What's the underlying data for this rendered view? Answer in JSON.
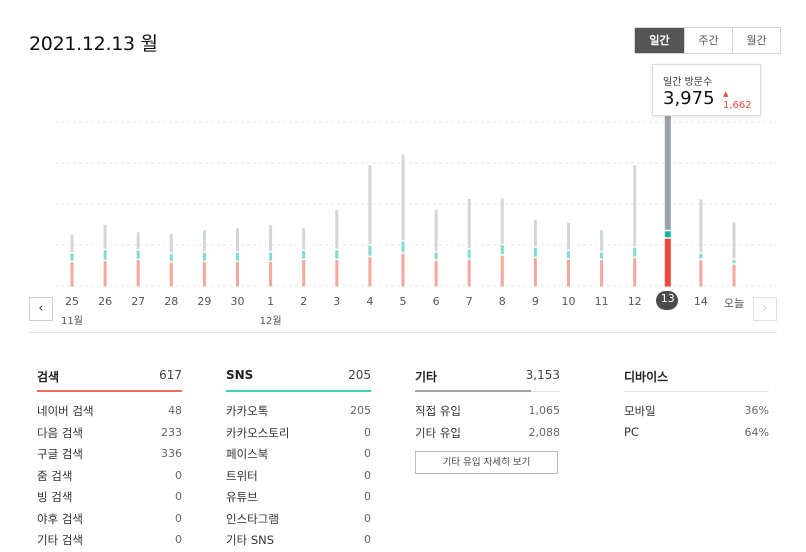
{
  "header": {
    "date_title": "2021.12.13 월"
  },
  "period_tabs": [
    {
      "label": "일간",
      "active": true
    },
    {
      "label": "주간",
      "active": false
    },
    {
      "label": "월간",
      "active": false
    }
  ],
  "tooltip": {
    "title": "일간 방문수",
    "value": "3,975",
    "diff": "1,662",
    "diff_direction": "up"
  },
  "chart_data": {
    "type": "bar",
    "stacked": true,
    "categories": [
      "25",
      "26",
      "27",
      "28",
      "29",
      "30",
      "1",
      "2",
      "3",
      "4",
      "5",
      "6",
      "7",
      "8",
      "9",
      "10",
      "11",
      "12",
      "13",
      "14",
      "오늘"
    ],
    "month_labels": [
      {
        "at": "25",
        "label": "11월"
      },
      {
        "at": "1",
        "label": "12월"
      }
    ],
    "selected_category": "13",
    "series": [
      {
        "color": "#f5a79b",
        "values": [
          520,
          540,
          560,
          510,
          520,
          520,
          520,
          560,
          560,
          620,
          690,
          550,
          570,
          650,
          600,
          570,
          560,
          600,
          990,
          560,
          470
        ]
      },
      {
        "color": "#7fdccf",
        "values": [
          170,
          220,
          190,
          170,
          190,
          190,
          190,
          190,
          200,
          230,
          240,
          160,
          200,
          210,
          210,
          170,
          150,
          210,
          150,
          130,
          90
        ]
      },
      {
        "color": "#d3d6d9",
        "values": [
          380,
          510,
          370,
          410,
          450,
          490,
          550,
          450,
          810,
          1620,
          1750,
          860,
          1020,
          940,
          560,
          570,
          450,
          1660,
          3200,
          1090,
          760
        ]
      }
    ],
    "selected_colors": [
      "#f0473b",
      "#19b4a0",
      "#9ca3aa"
    ],
    "ylim": [
      0,
      4100
    ],
    "grid": true,
    "legend": "none"
  },
  "nav": {
    "prev_symbol": "‹",
    "next_symbol": "›"
  },
  "stats": [
    {
      "name": "검색",
      "total": "617",
      "accent": "#f26b5c",
      "accent_fraction": 1.0,
      "rows": [
        {
          "label": "네이버 검색",
          "value": "48"
        },
        {
          "label": "다음 검색",
          "value": "233"
        },
        {
          "label": "구글 검색",
          "value": "336"
        },
        {
          "label": "줌 검색",
          "value": "0"
        },
        {
          "label": "빙 검색",
          "value": "0"
        },
        {
          "label": "야후 검색",
          "value": "0"
        },
        {
          "label": "기타 검색",
          "value": "0"
        }
      ]
    },
    {
      "name": "SNS",
      "total": "205",
      "accent": "#3ccfbb",
      "accent_fraction": 1.0,
      "rows": [
        {
          "label": "카카오톡",
          "value": "205"
        },
        {
          "label": "카카오스토리",
          "value": "0"
        },
        {
          "label": "페이스북",
          "value": "0"
        },
        {
          "label": "트위터",
          "value": "0"
        },
        {
          "label": "유튜브",
          "value": "0"
        },
        {
          "label": "인스타그램",
          "value": "0"
        },
        {
          "label": "기타 SNS",
          "value": "0"
        }
      ]
    },
    {
      "name": "기타",
      "total": "3,153",
      "accent": "#9aa3ab",
      "accent_fraction": 0.8,
      "rows": [
        {
          "label": "직접 유입",
          "value": "1,065"
        },
        {
          "label": "기타 유입",
          "value": "2,088"
        }
      ],
      "detail_button": "기타 유입 자세히 보기"
    },
    {
      "name": "디바이스",
      "total": "",
      "accent": "#e5e5e5",
      "accent_fraction": 0,
      "rows": [
        {
          "label": "모바일",
          "value": "36%"
        },
        {
          "label": "PC",
          "value": "64%"
        }
      ]
    }
  ]
}
